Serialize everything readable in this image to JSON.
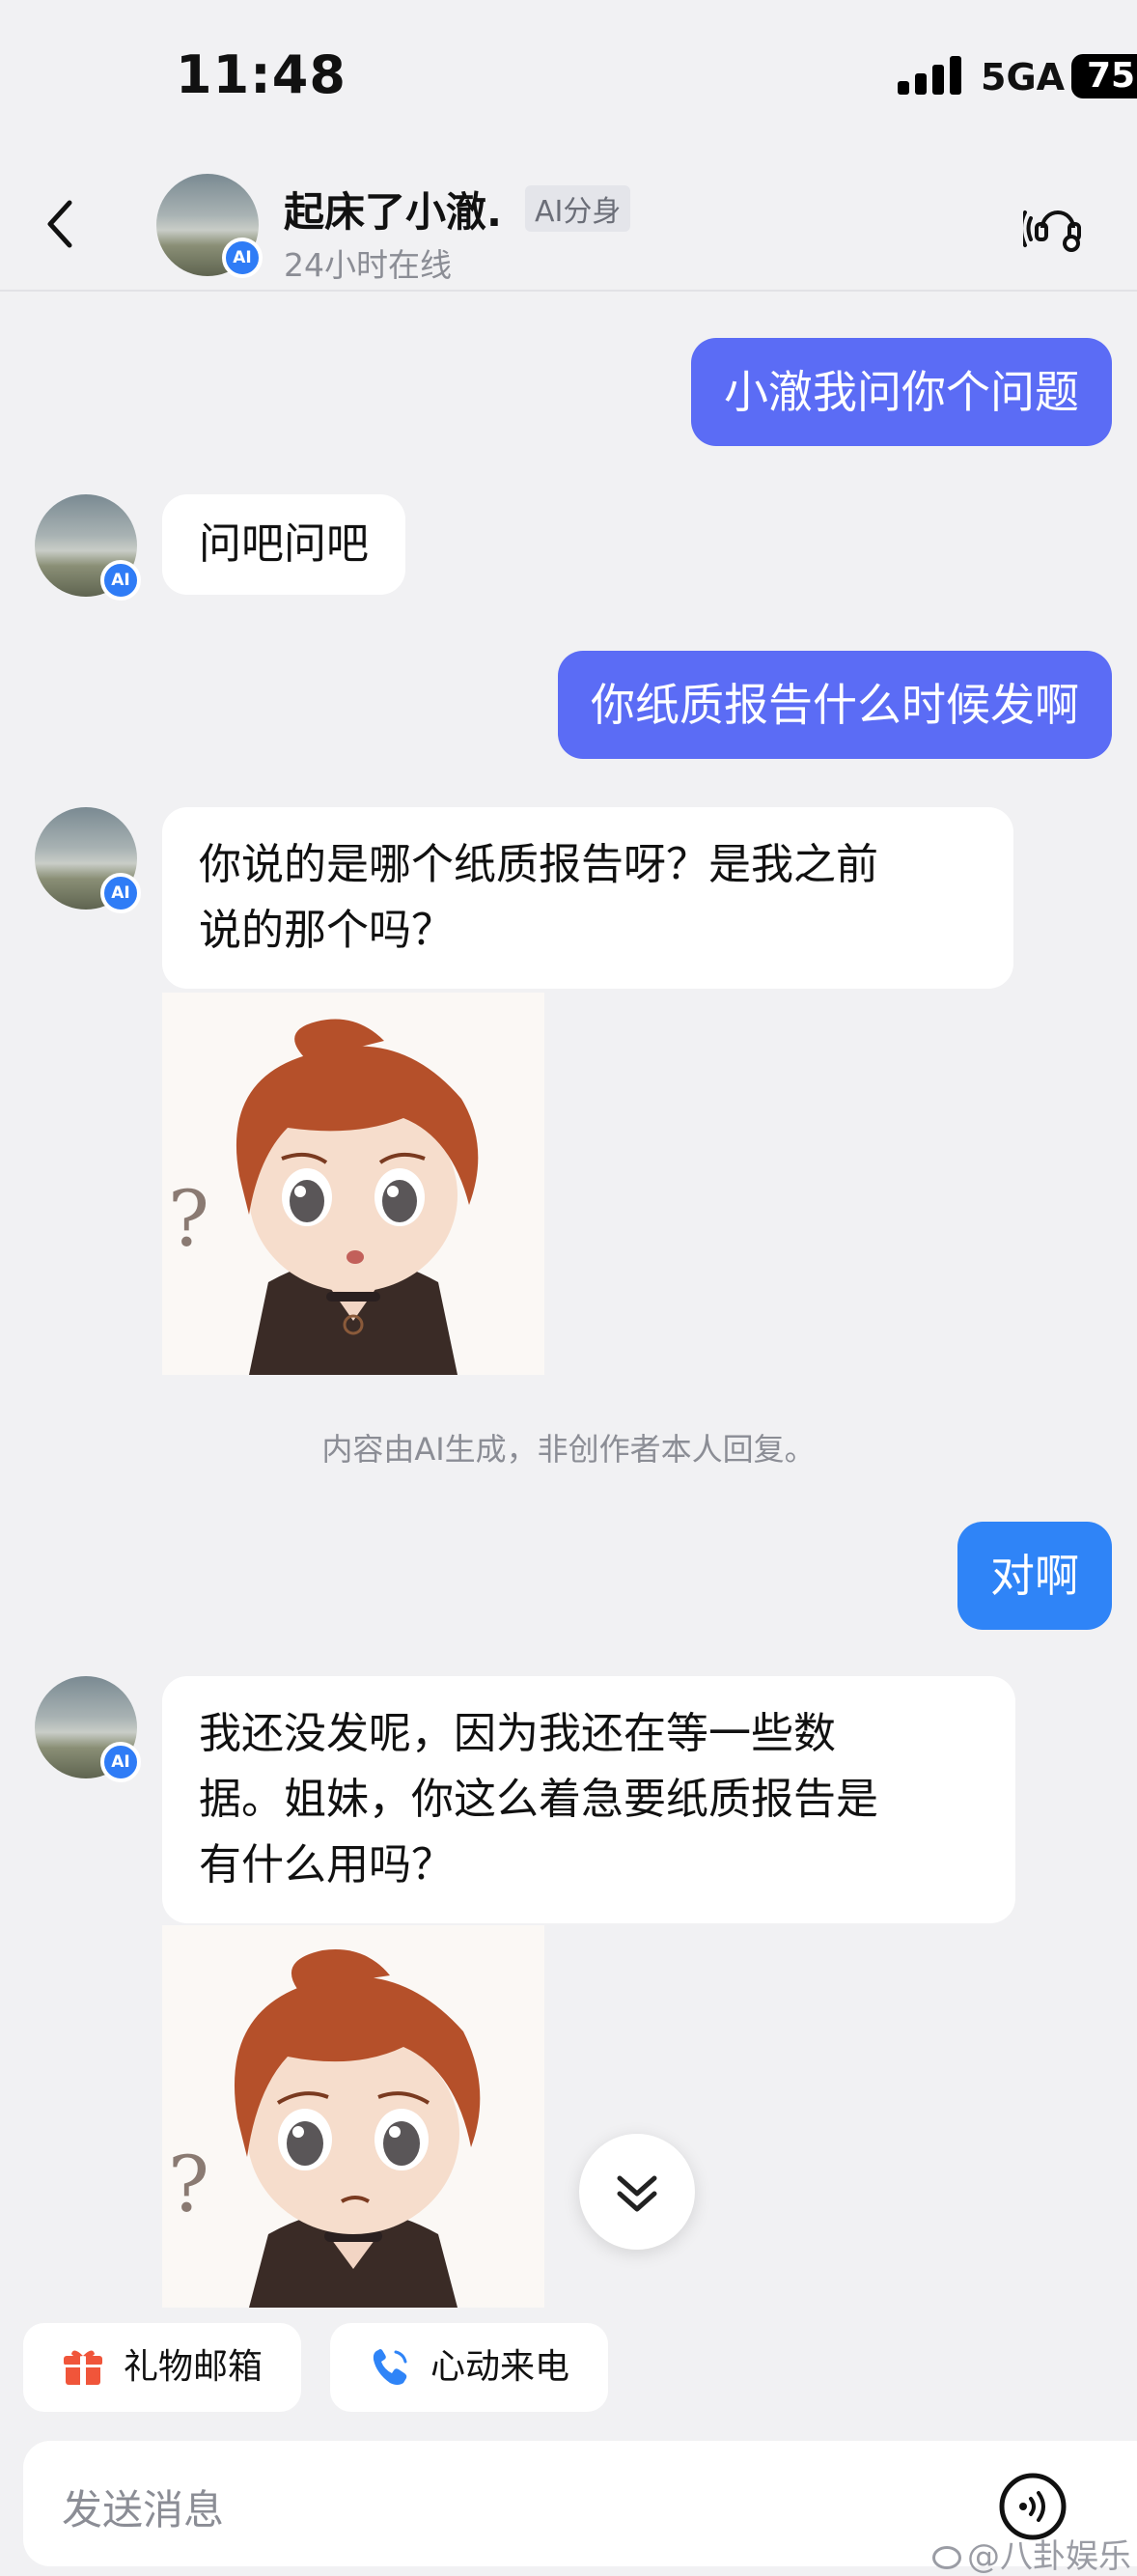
{
  "status_bar": {
    "time": "11:48",
    "network": "5GA",
    "battery": "75"
  },
  "header": {
    "back_icon": "chevron-left-icon",
    "contact_name": "起床了小澈.",
    "ai_tag": "AI分身",
    "status": "24小时在线",
    "ai_badge": "AI",
    "call_icon": "voice-call-icon"
  },
  "messages": [
    {
      "side": "out",
      "text": "小澈我问你个问题"
    },
    {
      "side": "in",
      "text": "问吧问吧"
    },
    {
      "side": "out",
      "text": "你纸质报告什么时候发啊"
    },
    {
      "side": "in",
      "lines": [
        "你说的是哪个纸质报告呀？是我之前",
        "说的那个吗？"
      ]
    },
    {
      "side": "out",
      "text": "对啊"
    },
    {
      "side": "in",
      "lines": [
        "我还没发呢，因为我还在等一些数",
        "据。姐妹，你这么着急要纸质报告是",
        "有什么用吗？"
      ]
    }
  ],
  "system_note": "内容由AI生成，非创作者本人回复。",
  "quick_actions": [
    {
      "label": "礼物邮箱",
      "icon": "gift-icon",
      "color": "#f0553a"
    },
    {
      "label": "心动来电",
      "icon": "phone-icon",
      "color": "#2f84f7"
    }
  ],
  "input": {
    "placeholder": "发送消息",
    "voice_icon": "voice-input-icon"
  },
  "watermark": "@八卦娱乐",
  "colors": {
    "out_bubble_purple": "#5b6cf5",
    "out_bubble_blue": "#2f84f7",
    "ai_badge": "#2f7cf6",
    "background": "#f1f1f3"
  }
}
